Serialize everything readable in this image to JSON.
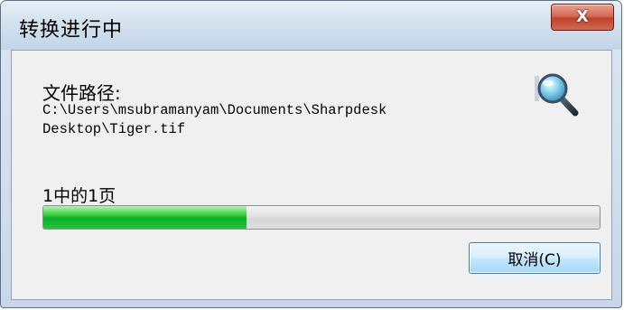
{
  "window": {
    "title": "转换进行中",
    "close_glyph": "X"
  },
  "dialog": {
    "path_label": "文件路径:",
    "path_lines": [
      "C:\\Users\\msubramanyam\\Documents\\Sharpdesk",
      "Desktop\\Tiger.tif"
    ],
    "page_status": "1中的1页",
    "progress_fraction": 0.365,
    "cancel_label": "取消(C)"
  },
  "colors": {
    "progress_fill": "#06b025",
    "close_button": "#c1412b",
    "window_frame": "#c8d8ea"
  },
  "icons": {
    "close": "close-icon",
    "search": "search-icon"
  }
}
